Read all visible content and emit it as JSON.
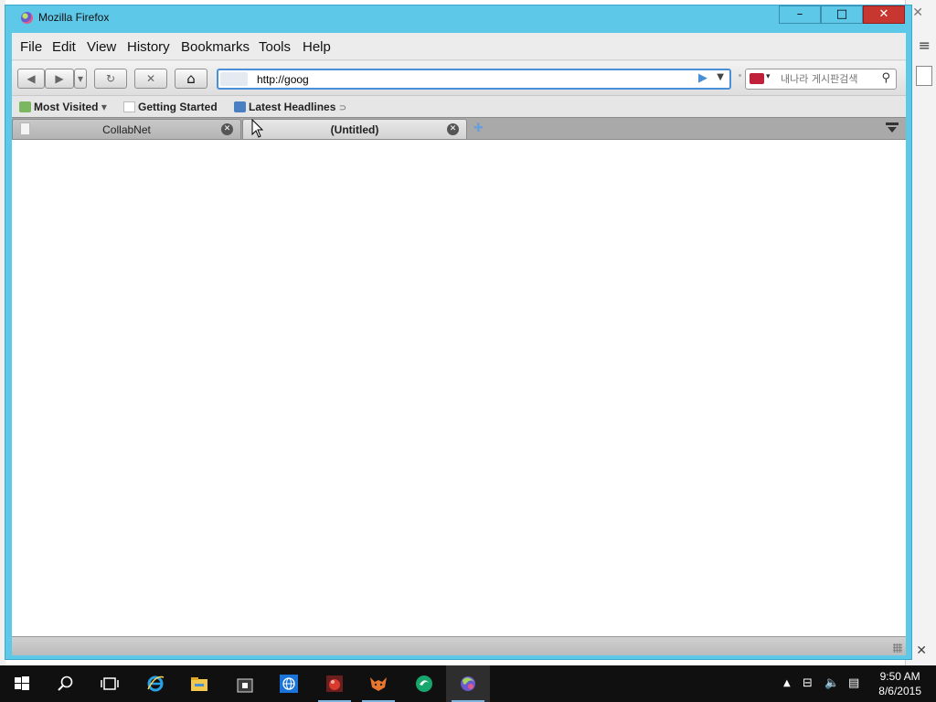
{
  "window": {
    "title": "Mozilla Firefox",
    "controls": {
      "minimize": "–",
      "maximize": "□",
      "close": "✕"
    }
  },
  "menubar": {
    "items": [
      {
        "label": "File"
      },
      {
        "label": "Edit"
      },
      {
        "label": "View"
      },
      {
        "label": "History"
      },
      {
        "label": "Bookmarks"
      },
      {
        "label": "Tools"
      },
      {
        "label": "Help"
      }
    ]
  },
  "navbar": {
    "back_icon": "◀",
    "forward_icon": "▶",
    "history_dropdown_icon": "▾",
    "reload_icon": "↻",
    "stop_icon": "✕",
    "home_icon": "⌂",
    "url_value": "http://goog",
    "go_icon": "▶",
    "url_dropdown_icon": "▼",
    "search_engine_arrow": "▾",
    "search_placeholder": "내나라 게시판검색",
    "search_icon": "⚲"
  },
  "bookmarks": {
    "items": [
      {
        "label": "Most Visited",
        "icon": "star-icon",
        "arrow": "▾"
      },
      {
        "label": "Getting Started",
        "icon": "page-icon"
      },
      {
        "label": "Latest Headlines",
        "icon": "rss-icon",
        "suffix": "⊃"
      }
    ]
  },
  "tabs": {
    "items": [
      {
        "label": "CollabNet",
        "active": false,
        "close": "✕"
      },
      {
        "label": "(Untitled)",
        "active": true,
        "close": "✕"
      }
    ],
    "new_tab_icon": "✚"
  },
  "taskbar": {
    "apps": [
      {
        "name": "start",
        "icon": "windows-logo-icon"
      },
      {
        "name": "search",
        "icon": "search-icon"
      },
      {
        "name": "task-view",
        "icon": "task-view-icon"
      },
      {
        "name": "internet-explorer",
        "icon": "ie-icon"
      },
      {
        "name": "file-explorer",
        "icon": "folder-icon"
      },
      {
        "name": "store",
        "icon": "store-icon"
      },
      {
        "name": "browser",
        "icon": "globe-icon"
      },
      {
        "name": "app-red",
        "icon": "bug-icon"
      },
      {
        "name": "app-fox",
        "icon": "fox-icon"
      },
      {
        "name": "app-green",
        "icon": "green-circle-icon"
      },
      {
        "name": "firefox",
        "icon": "firefox-icon"
      }
    ],
    "tray": {
      "chevron": "▲",
      "network": "⊟",
      "volume": "🔈",
      "notification": "▤"
    },
    "clock": {
      "time": "9:50 AM",
      "date": "8/6/2015"
    }
  },
  "background_window": {
    "close": "✕",
    "menu": "≡",
    "close2": "✕"
  },
  "colors": {
    "window_frame": "#5ec8e8",
    "close_button": "#c7372f",
    "url_focus": "#4a90d9",
    "taskbar": "#101010"
  }
}
